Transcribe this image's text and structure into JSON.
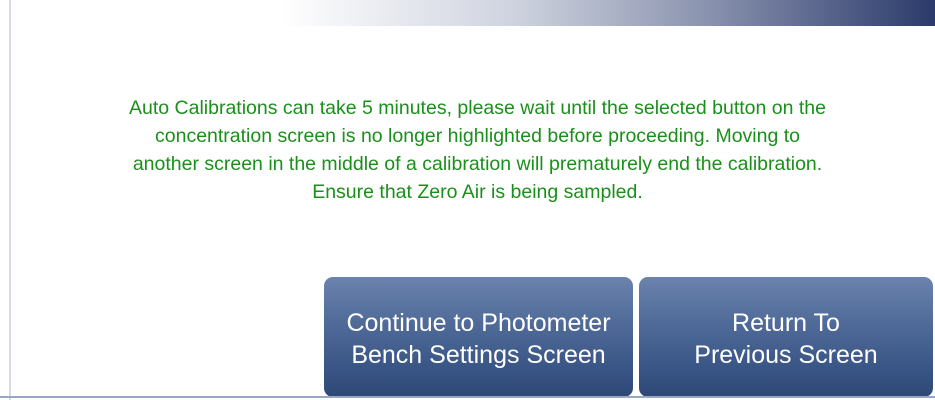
{
  "message": "Auto Calibrations can take 5 minutes, please wait until the selected button on the\nconcentration screen is no longer  highlighted before proceeding. Moving to\nanother screen in the middle of a calibration will prematurely end the calibration.\nEnsure that Zero Air is being sampled.",
  "buttons": {
    "continue_label": "Continue to Photometer\nBench Settings Screen",
    "return_label": "Return To\nPrevious Screen"
  },
  "colors": {
    "message_text": "#1b8f1b",
    "button_fill": "#3a5686",
    "button_text": "#ffffff",
    "header_gradient_end": "#2b3a6b"
  }
}
